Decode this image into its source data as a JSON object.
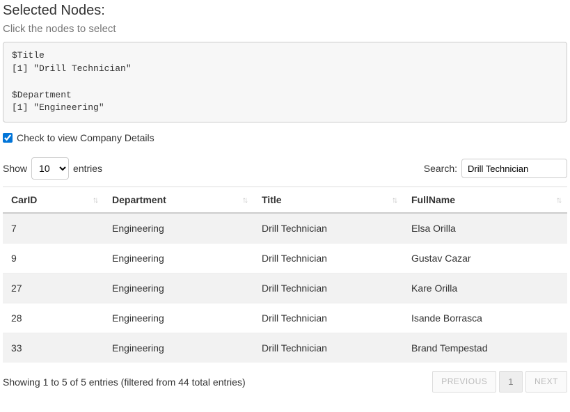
{
  "header": {
    "title": "Selected Nodes:",
    "subtitle": "Click the nodes to select"
  },
  "code": "$Title\n[1] \"Drill Technician\"\n\n$Department\n[1] \"Engineering\"",
  "checkbox": {
    "label": "Check to view Company Details",
    "checked": true
  },
  "length": {
    "prefix": "Show",
    "value": "10",
    "suffix": "entries"
  },
  "search": {
    "label": "Search:",
    "value": "Drill Technician"
  },
  "columns": [
    "CarID",
    "Department",
    "Title",
    "FullName"
  ],
  "rows": [
    {
      "CarID": "7",
      "Department": "Engineering",
      "Title": "Drill Technician",
      "FullName": "Elsa Orilla"
    },
    {
      "CarID": "9",
      "Department": "Engineering",
      "Title": "Drill Technician",
      "FullName": "Gustav Cazar"
    },
    {
      "CarID": "27",
      "Department": "Engineering",
      "Title": "Drill Technician",
      "FullName": "Kare Orilla"
    },
    {
      "CarID": "28",
      "Department": "Engineering",
      "Title": "Drill Technician",
      "FullName": "Isande Borrasca"
    },
    {
      "CarID": "33",
      "Department": "Engineering",
      "Title": "Drill Technician",
      "FullName": "Brand Tempestad"
    }
  ],
  "info": "Showing 1 to 5 of 5 entries (filtered from 44 total entries)",
  "paginate": {
    "previous": "Previous",
    "current": "1",
    "next": "Next"
  }
}
